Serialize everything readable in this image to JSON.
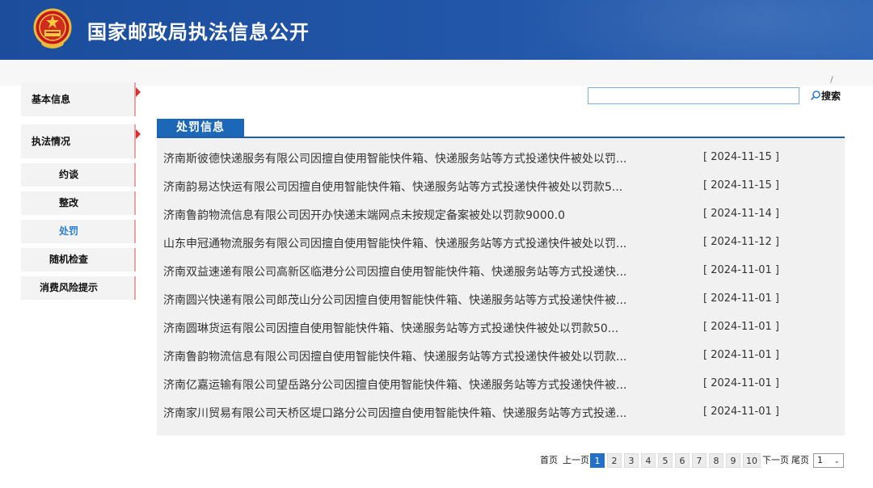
{
  "header": {
    "title": "国家邮政局执法信息公开"
  },
  "sidebar": {
    "sections": [
      {
        "label": "基本信息"
      },
      {
        "label": "执法情况"
      }
    ],
    "subitems": [
      {
        "label": "约谈"
      },
      {
        "label": "整改"
      },
      {
        "label": "处罚"
      },
      {
        "label": "随机检查"
      },
      {
        "label": "消费风险提示"
      }
    ],
    "active": "处罚"
  },
  "search": {
    "placeholder": "",
    "button_label": "搜索"
  },
  "misc": {
    "slash": "/"
  },
  "panel": {
    "tab_label": "处罚信息",
    "items": [
      {
        "title": "济南斯彼德快递服务有限公司因擅自使用智能快件箱、快递服务站等方式投递快件被处以罚...",
        "date": "[ 2024-11-15 ]"
      },
      {
        "title": "济南韵易达快运有限公司因擅自使用智能快件箱、快递服务站等方式投递快件被处以罚款5...",
        "date": "[ 2024-11-15 ]"
      },
      {
        "title": "济南鲁韵物流信息有限公司因开办快递末端网点未按规定备案被处以罚款9000.0",
        "date": "[ 2024-11-14 ]"
      },
      {
        "title": "山东申冠通物流服务有限公司因擅自使用智能快件箱、快递服务站等方式投递快件被处以罚...",
        "date": "[ 2024-11-12 ]"
      },
      {
        "title": "济南双益速递有限公司高新区临港分公司因擅自使用智能快件箱、快递服务站等方式投递快...",
        "date": "[ 2024-11-01 ]"
      },
      {
        "title": "济南圆兴快递有限公司郎茂山分公司因擅自使用智能快件箱、快递服务站等方式投递快件被...",
        "date": "[ 2024-11-01 ]"
      },
      {
        "title": "济南圆琳货运有限公司因擅自使用智能快件箱、快递服务站等方式投递快件被处以罚款50...",
        "date": "[ 2024-11-01 ]"
      },
      {
        "title": "济南鲁韵物流信息有限公司因擅自使用智能快件箱、快递服务站等方式投递快件被处以罚款...",
        "date": "[ 2024-11-01 ]"
      },
      {
        "title": "济南亿嘉运输有限公司望岳路分公司因擅自使用智能快件箱、快递服务站等方式投递快件被...",
        "date": "[ 2024-11-01 ]"
      },
      {
        "title": "济南家川贸易有限公司天桥区堤口路分公司因擅自使用智能快件箱、快递服务站等方式投递...",
        "date": "[ 2024-11-01 ]"
      }
    ]
  },
  "pagination": {
    "first": "首页",
    "prev": "上一页",
    "pages": [
      "1",
      "2",
      "3",
      "4",
      "5",
      "6",
      "7",
      "8",
      "9",
      "10"
    ],
    "current": "1",
    "next": "下一页",
    "last": "尾页",
    "select_value": "1"
  },
  "colors": {
    "header_blue": "#1b4d9c",
    "accent_blue": "#1d67b8",
    "active_link": "#2c7fd8",
    "marker_red": "#d9322e"
  }
}
